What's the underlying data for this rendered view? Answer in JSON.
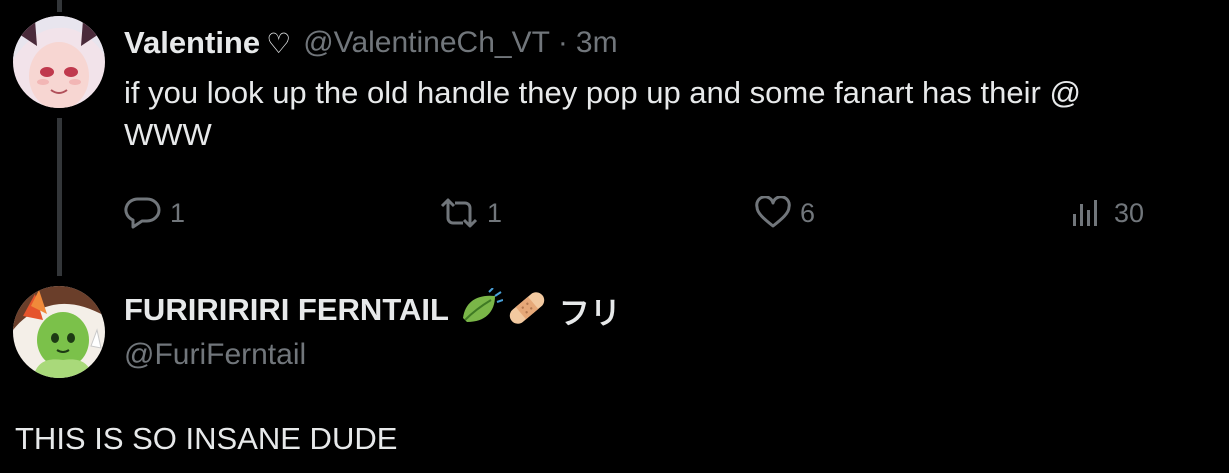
{
  "tweet1": {
    "name": "Valentine",
    "name_suffix": "♡",
    "handle": "@ValentineCh_VT",
    "separator": "·",
    "time": "3m",
    "text_line1": "if you look up the old handle they pop up and some fanart has their @",
    "text_line2": "WWW",
    "actions": {
      "replies": "1",
      "reposts": "1",
      "likes": "6",
      "views": "30"
    }
  },
  "tweet2": {
    "name": "FURIRIRIRI FERNTAIL",
    "name_suffix": "フリ",
    "name_emoji": [
      "leaf-icon",
      "bandage-icon"
    ],
    "handle": "@FuriFerntail",
    "text": "THIS IS SO INSANE DUDE"
  },
  "colors": {
    "background": "#000000",
    "text": "#e7e9ea",
    "muted": "#71767b",
    "thread_line": "#333639"
  }
}
